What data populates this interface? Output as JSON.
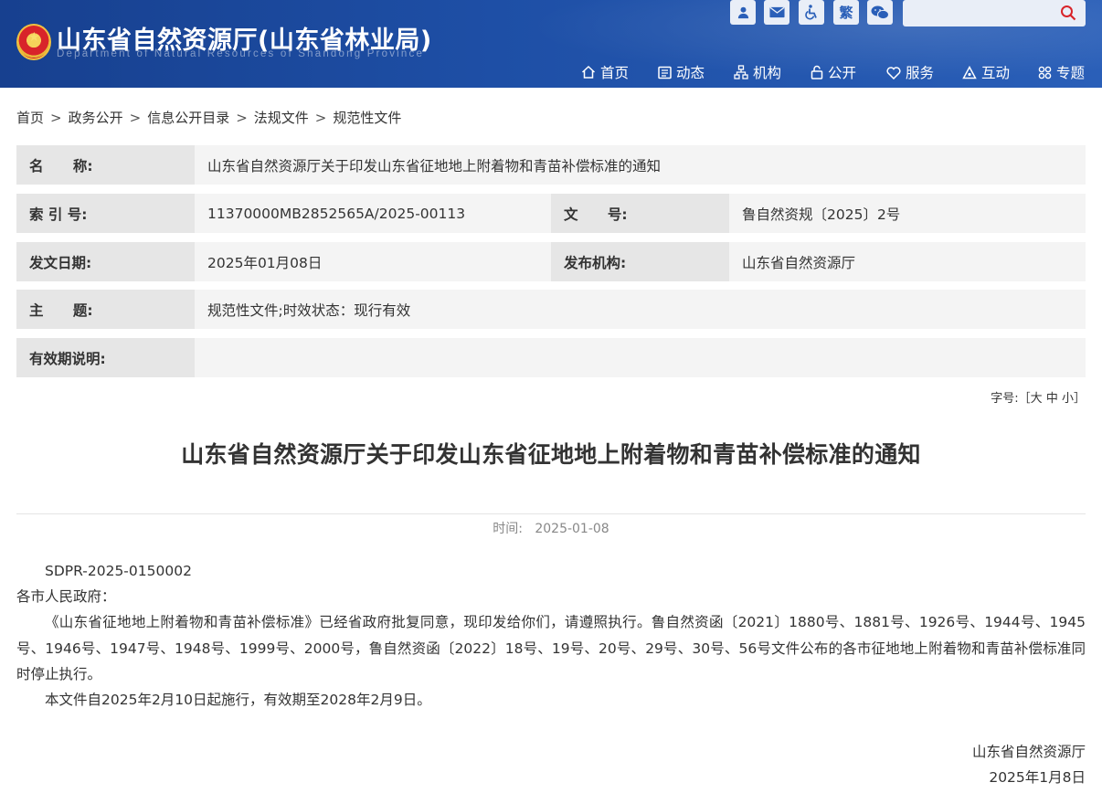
{
  "header": {
    "site_title": "山东省自然资源厅(山东省林业局)",
    "site_subtitle": "Department of Natural Resources of Shandong Province",
    "tools": {
      "user_icon": "user-icon",
      "mail_icon": "mail-icon",
      "accessibility_icon": "wheelchair-icon",
      "traditional_label": "繁",
      "wechat_icon": "wechat-icon"
    },
    "search": {
      "placeholder": "",
      "icon": "search-icon"
    },
    "nav": [
      {
        "label": "首页",
        "icon": "home-icon"
      },
      {
        "label": "动态",
        "icon": "news-icon"
      },
      {
        "label": "机构",
        "icon": "org-icon"
      },
      {
        "label": "公开",
        "icon": "lock-icon"
      },
      {
        "label": "服务",
        "icon": "heart-icon"
      },
      {
        "label": "互动",
        "icon": "interact-icon"
      },
      {
        "label": "专题",
        "icon": "grid-icon"
      }
    ]
  },
  "breadcrumb": [
    "首页",
    "政务公开",
    "信息公开目录",
    "法规文件",
    "规范性文件"
  ],
  "breadcrumb_separator": ">",
  "info": {
    "name_label": "名      称:",
    "name_value": "山东省自然资源厅关于印发山东省征地地上附着物和青苗补偿标准的通知",
    "index_label": "索 引 号:",
    "index_value": "11370000MB2852565A/2025-00113",
    "docno_label": "文      号:",
    "docno_value": "鲁自然资规〔2025〕2号",
    "date_label": "发文日期:",
    "date_value": "2025年01月08日",
    "issuer_label": "发布机构:",
    "issuer_value": "山东省自然资源厅",
    "subject_label": "主      题:",
    "subject_value": "规范性文件;时效状态：现行有效",
    "validity_label": "有效期说明:",
    "validity_value": ""
  },
  "font_size": {
    "label": "字号:",
    "open": "［",
    "large": "大",
    "medium": "中",
    "small": "小",
    "close": "］"
  },
  "article": {
    "title": "山东省自然资源厅关于印发山东省征地地上附着物和青苗补偿标准的通知",
    "time_label": "时间:",
    "time_value": "2025-01-08",
    "doc_code": "SDPR-2025-0150002",
    "addressee": "各市人民政府：",
    "paragraph1": "《山东省征地地上附着物和青苗补偿标准》已经省政府批复同意，现印发给你们，请遵照执行。鲁自然资函〔2021〕1880号、1881号、1926号、1944号、1945号、1946号、1947号、1948号、1999号、2000号，鲁自然资函〔2022〕18号、19号、20号、29号、30号、56号文件公布的各市征地地上附着物和青苗补偿标准同时停止执行。",
    "paragraph2": "本文件自2025年2月10日起施行，有效期至2028年2月9日。",
    "signature": "山东省自然资源厅",
    "sign_date": "2025年1月8日"
  }
}
